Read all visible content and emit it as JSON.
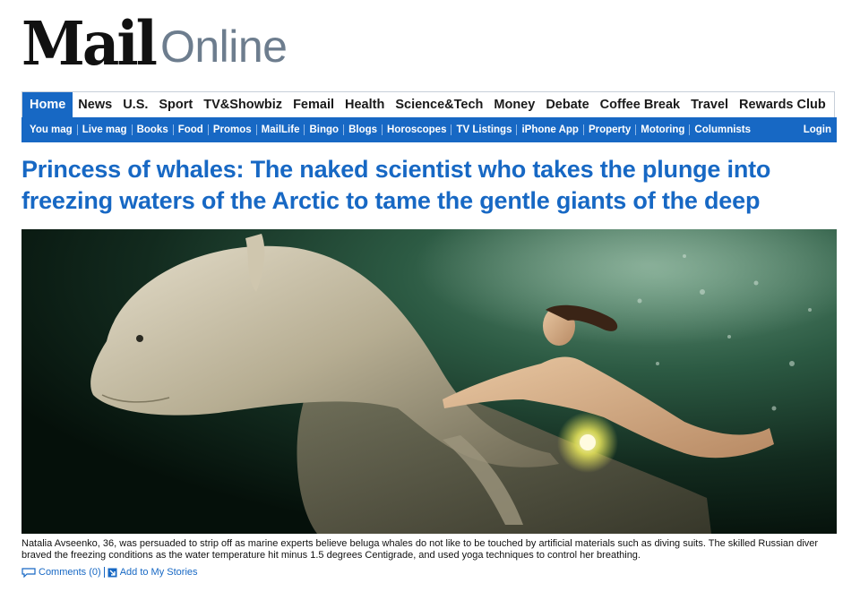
{
  "brand": {
    "logo_word": "Mail",
    "logo_suffix": "Online"
  },
  "colors": {
    "accent": "#1768c4",
    "logo_gray": "#6d7d8e"
  },
  "nav_primary": [
    {
      "label": "Home",
      "active": true
    },
    {
      "label": "News"
    },
    {
      "label": "U.S."
    },
    {
      "label": "Sport"
    },
    {
      "label": "TV&Showbiz"
    },
    {
      "label": "Femail"
    },
    {
      "label": "Health"
    },
    {
      "label": "Science&Tech"
    },
    {
      "label": "Money"
    },
    {
      "label": "Debate"
    },
    {
      "label": "Coffee Break"
    },
    {
      "label": "Travel"
    },
    {
      "label": "Rewards Club"
    }
  ],
  "nav_secondary": [
    {
      "label": "You mag"
    },
    {
      "label": "Live mag"
    },
    {
      "label": "Books"
    },
    {
      "label": "Food"
    },
    {
      "label": "Promos"
    },
    {
      "label": "MailLife"
    },
    {
      "label": "Bingo"
    },
    {
      "label": "Blogs"
    },
    {
      "label": "Horoscopes"
    },
    {
      "label": "TV Listings"
    },
    {
      "label": "iPhone App"
    },
    {
      "label": "Property"
    },
    {
      "label": "Motoring"
    },
    {
      "label": "Columnists"
    }
  ],
  "login_label": "Login",
  "article": {
    "headline": "Princess of whales: The naked scientist who takes the plunge into freezing waters of the Arctic to tame the gentle giants of the deep",
    "caption": "Natalia Avseenko, 36, was persuaded to strip off as marine experts believe beluga whales do not like to be touched by artificial materials such as diving suits. The skilled Russian diver braved the freezing conditions as the water temperature hit minus 1.5 degrees Centigrade, and used yoga techniques to control her breathing.",
    "comments_label": "Comments (0)",
    "add_stories_label": "Add to My Stories"
  },
  "icons": {
    "comments": "speech-bubble-icon",
    "add": "add-story-icon"
  }
}
